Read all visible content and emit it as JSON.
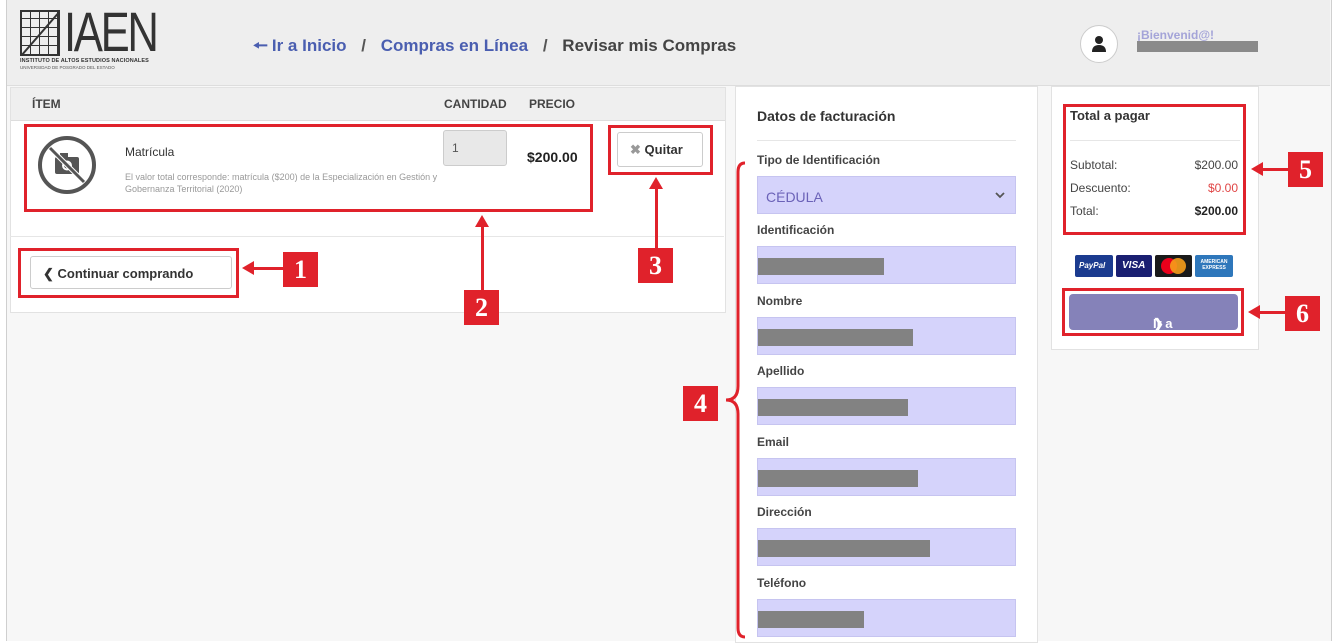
{
  "logo": {
    "text": "IAEN",
    "subtitle": "INSTITUTO DE ALTOS ESTUDIOS NACIONALES",
    "subtitle2": "UNIVERSIDAD DE POSGRADO DEL ESTADO"
  },
  "breadcrumb": {
    "home": "Ir a Inicio",
    "sep": "/",
    "shop": "Compras en Línea",
    "current": "Revisar mis Compras"
  },
  "user": {
    "welcome": "¡Bienvenid@!"
  },
  "cart": {
    "headers": {
      "item": "ÍTEM",
      "qty": "CANTIDAD",
      "price": "PRECIO"
    },
    "item": {
      "name": "Matrícula",
      "description": "El valor total corresponde: matrícula ($200) de la Especialización en Gestión y Gobernanza Territorial (2020)",
      "quantity": "1",
      "price": "$200.00"
    },
    "remove_label": "Quitar",
    "continue_label": "Continuar comprando"
  },
  "billing": {
    "title": "Datos de facturación",
    "id_type_label": "Tipo de Identificación",
    "id_type_value": "CÉDULA",
    "id_label": "Identificación",
    "name_label": "Nombre",
    "lastname_label": "Apellido",
    "email_label": "Email",
    "address_label": "Dirección",
    "phone_label": "Teléfono"
  },
  "totals": {
    "title": "Total a pagar",
    "subtotal_label": "Subtotal:",
    "subtotal": "$200.00",
    "discount_label": "Descuento:",
    "discount": "$0.00",
    "total_label": "Total:",
    "total": "$200.00",
    "pay_label": "Ir a pagar"
  },
  "payment_methods": {
    "paypal": "PayPal",
    "visa": "VISA",
    "amex": "AMERICAN EXPRESS"
  },
  "annotations": [
    "1",
    "2",
    "3",
    "4",
    "5",
    "6"
  ],
  "colors": {
    "accent": "#8582b9",
    "link": "#4a5eb0",
    "input_bg": "#d5d3fb",
    "annotation": "#e0222b"
  }
}
